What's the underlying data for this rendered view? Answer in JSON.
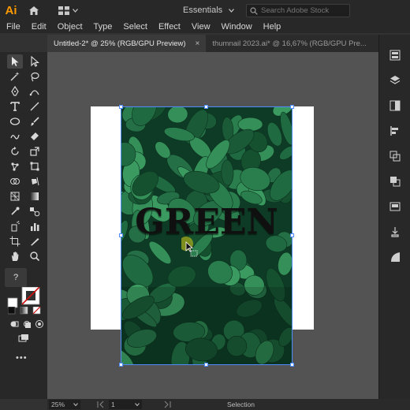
{
  "app": {
    "logo": "Ai",
    "workspace": "Essentials",
    "stock_search_placeholder": "Search Adobe Stock"
  },
  "menu": [
    "File",
    "Edit",
    "Object",
    "Type",
    "Select",
    "Effect",
    "View",
    "Window",
    "Help"
  ],
  "tabs": [
    {
      "label": "Untitled-2* @ 25% (RGB/GPU Preview)",
      "close": "×",
      "active": true
    },
    {
      "label": "thumnail 2023.ai* @ 16,67% (RGB/GPU Pre...",
      "close": "",
      "active": false
    }
  ],
  "canvas": {
    "artwork_text": "GREEN"
  },
  "toolbar": {
    "help_glyph": "?",
    "more_glyph": "•••"
  },
  "status": {
    "zoom": "25%",
    "page": "1",
    "mode": "Selection"
  },
  "colors": {
    "accent": "#ff9a00",
    "selection": "#4d8bff",
    "leaf_dark": "#0f3a24",
    "leaf_light": "#2e8a55"
  }
}
